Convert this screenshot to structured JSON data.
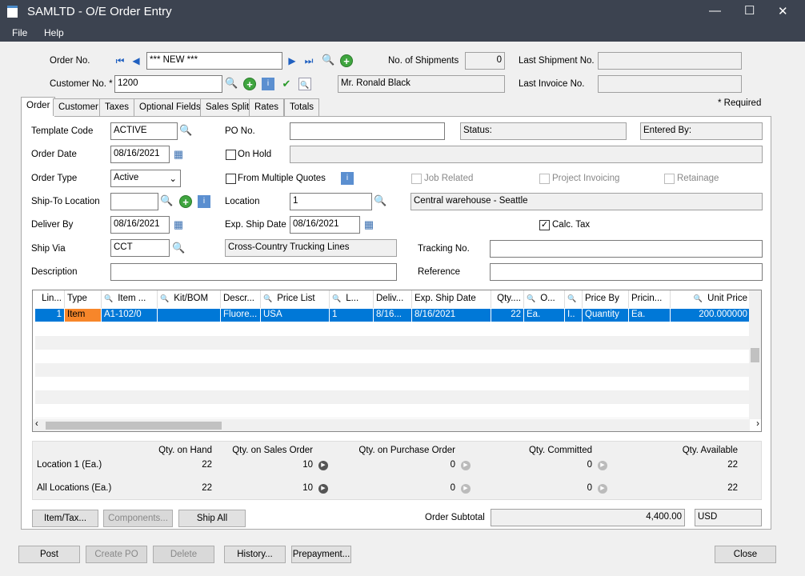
{
  "window": {
    "title": "SAMLTD - O/E Order Entry",
    "minimize": "—",
    "maximize": "☐",
    "close": "✕"
  },
  "menu": [
    "File",
    "Help"
  ],
  "header": {
    "order_no_label": "Order No.",
    "order_no": "*** NEW ***",
    "customer_no_label": "Customer No. *",
    "customer_no": "1200",
    "customer_name": "Mr. Ronald Black",
    "shipments_label": "No. of Shipments",
    "shipments": "0",
    "last_shipment_label": "Last Shipment No.",
    "last_shipment": "",
    "last_invoice_label": "Last Invoice No.",
    "last_invoice": "",
    "required_note": "*  Required"
  },
  "tabs": [
    "Order",
    "Customer",
    "Taxes",
    "Optional Fields",
    "Sales Split",
    "Rates",
    "Totals"
  ],
  "order": {
    "template_code_label": "Template Code",
    "template_code": "ACTIVE",
    "order_date_label": "Order Date",
    "order_date": "08/16/2021",
    "order_type_label": "Order Type",
    "order_type": "Active",
    "ship_to_label": "Ship-To Location",
    "ship_to": "",
    "deliver_by_label": "Deliver By",
    "deliver_by": "08/16/2021",
    "ship_via_label": "Ship Via",
    "ship_via": "CCT",
    "ship_via_desc": "Cross-Country Trucking Lines",
    "description_label": "Description",
    "description": "",
    "po_no_label": "PO No.",
    "po_no": "",
    "status": "Status:",
    "entered_by": "Entered By:",
    "on_hold_label": "On Hold",
    "on_hold": false,
    "multiple_quotes_label": "From Multiple Quotes",
    "multiple_quotes": false,
    "job_related_label": "Job Related",
    "project_invoicing_label": "Project Invoicing",
    "retainage_label": "Retainage",
    "location_label": "Location",
    "location": "1",
    "location_desc": "Central warehouse - Seattle",
    "exp_ship_label": "Exp. Ship Date",
    "exp_ship": "08/16/2021",
    "calc_tax_label": "Calc. Tax",
    "calc_tax": true,
    "tracking_label": "Tracking No.",
    "tracking": "",
    "reference_label": "Reference",
    "reference": ""
  },
  "grid": {
    "columns": [
      "Lin...",
      "Type",
      "Item ...",
      "Kit/BOM",
      "Descr...",
      "Price List",
      "L...",
      "Deliv...",
      "Exp. Ship Date",
      "Qty....",
      "O...",
      "",
      "Price By",
      "Pricin...",
      "Unit Price"
    ],
    "rows": [
      [
        "1",
        "Item",
        "A1-102/0",
        "",
        "Fluore...",
        "USA",
        "1",
        "8/16...",
        "8/16/2021",
        "22",
        "Ea.",
        "I..",
        "Quantity",
        "Ea.",
        "200.000000"
      ]
    ],
    "type_color": "#f7862a",
    "selected_color": "#0078d7"
  },
  "inventory": {
    "headers": [
      "Qty. on Hand",
      "Qty. on Sales Order",
      "Qty. on Purchase Order",
      "Qty. Committed",
      "Qty. Available"
    ],
    "rows": [
      {
        "label": "Location  1 (Ea.)",
        "values": [
          "22",
          "10",
          "0",
          "0",
          "22"
        ]
      },
      {
        "label": "All Locations (Ea.)",
        "values": [
          "22",
          "10",
          "0",
          "0",
          "22"
        ]
      }
    ]
  },
  "buttons": {
    "item_tax": "Item/Tax...",
    "components": "Components...",
    "ship_all": "Ship All",
    "post": "Post",
    "create_po": "Create PO",
    "delete": "Delete",
    "history": "History...",
    "prepayment": "Prepayment...",
    "close": "Close"
  },
  "subtotal": {
    "label": "Order Subtotal",
    "value": "4,400.00",
    "currency": "USD"
  }
}
